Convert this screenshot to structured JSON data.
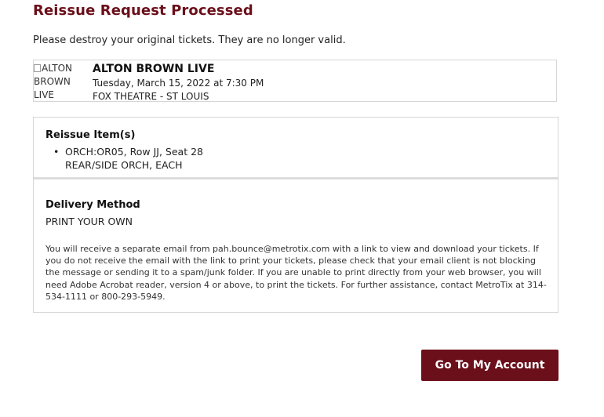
{
  "page": {
    "title": "Reissue Request Processed",
    "notice": "Please destroy your original tickets. They are no longer valid."
  },
  "event": {
    "image_alt_lines": [
      "ALTON",
      "BROWN",
      "LIVE"
    ],
    "name": "ALTON BROWN LIVE",
    "datetime": "Tuesday, March 15, 2022 at 7:30 PM",
    "venue": "FOX THEATRE - ST LOUIS"
  },
  "reissue": {
    "heading": "Reissue Item(s)",
    "items": [
      {
        "line1": "ORCH:OR05, Row JJ, Seat 28",
        "line2": "REAR/SIDE ORCH, EACH"
      }
    ]
  },
  "delivery": {
    "heading": "Delivery Method",
    "method": "PRINT YOUR OWN",
    "note": "You will receive a separate email from pah.bounce@metrotix.com with a link to view and download your tickets. If you do not receive the email with the link to print your tickets, please check that your email client is not blocking the message or sending it to a spam/junk folder. If you are unable to print directly from your web browser, you will need Adobe Acrobat reader, version 4 or above, to print the tickets. For further assistance, contact MetroTix at 314-534-1111 or 800-293-5949."
  },
  "actions": {
    "account_button": "Go To My Account"
  },
  "colors": {
    "brand": "#6b0f1a"
  }
}
